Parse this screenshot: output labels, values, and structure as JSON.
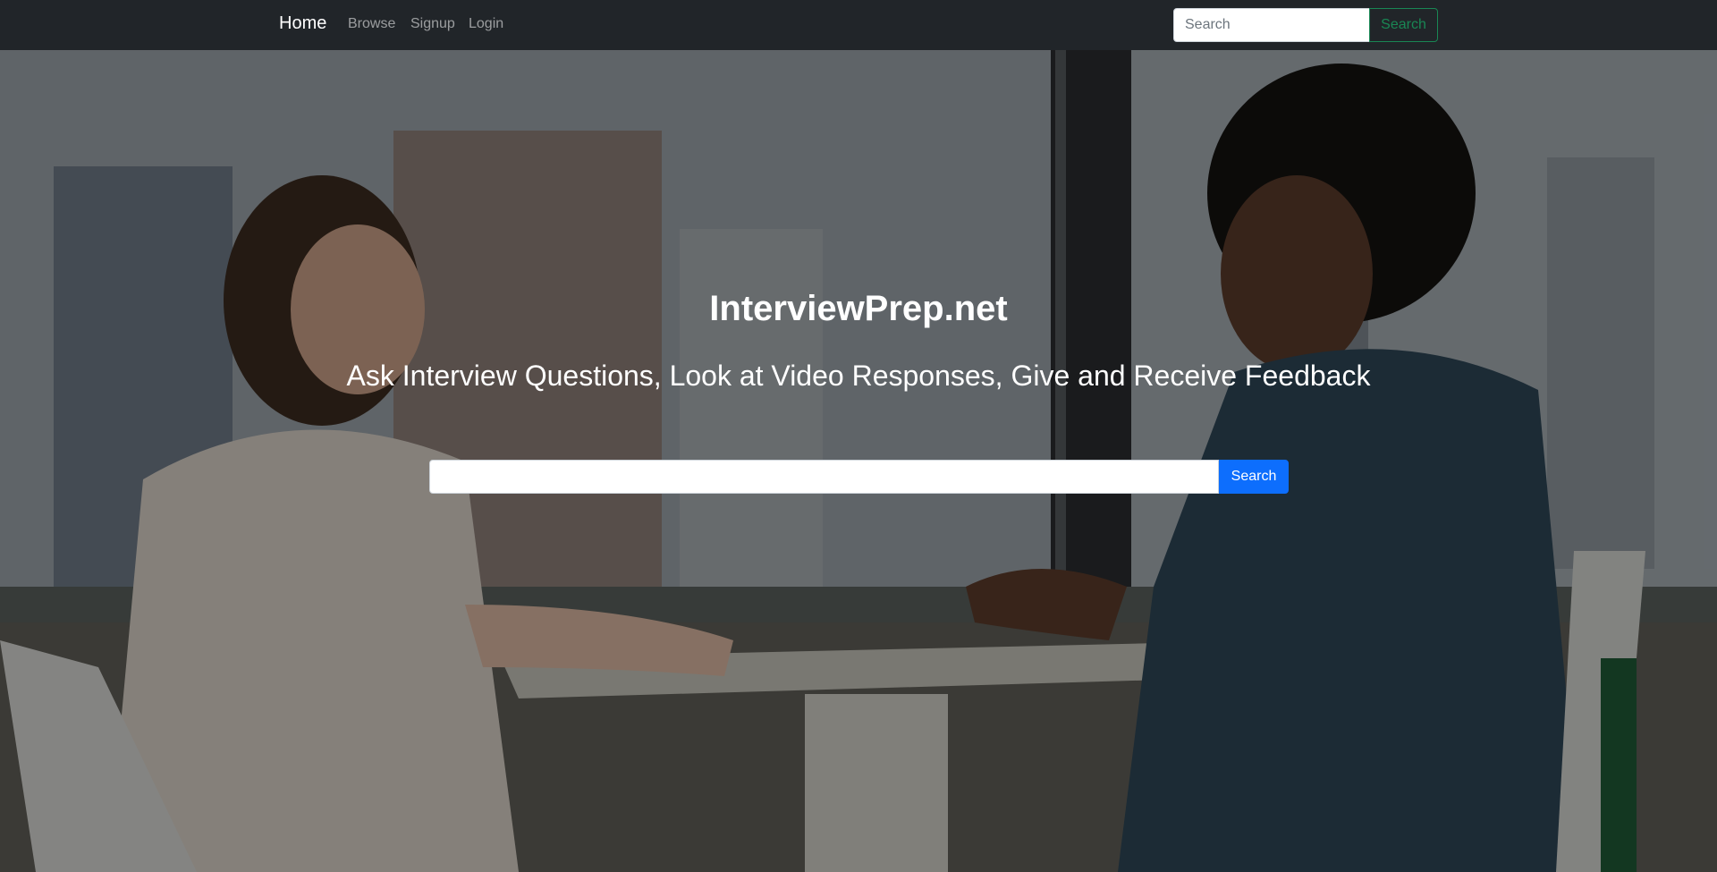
{
  "navbar": {
    "brand": "Home",
    "links": [
      {
        "label": "Browse"
      },
      {
        "label": "Signup"
      },
      {
        "label": "Login"
      }
    ],
    "search": {
      "placeholder": "Search",
      "button_label": "Search"
    }
  },
  "hero": {
    "title": "InterviewPrep.net",
    "subtitle": "Ask Interview Questions, Look at Video Responses, Give and Receive Feedback",
    "search": {
      "value": "",
      "button_label": "Search"
    },
    "background_image": "two-women-interview-at-table-photo"
  },
  "colors": {
    "navbar_bg": "#212529",
    "nav_search_button": "#198754",
    "hero_search_button": "#0d6efd"
  }
}
